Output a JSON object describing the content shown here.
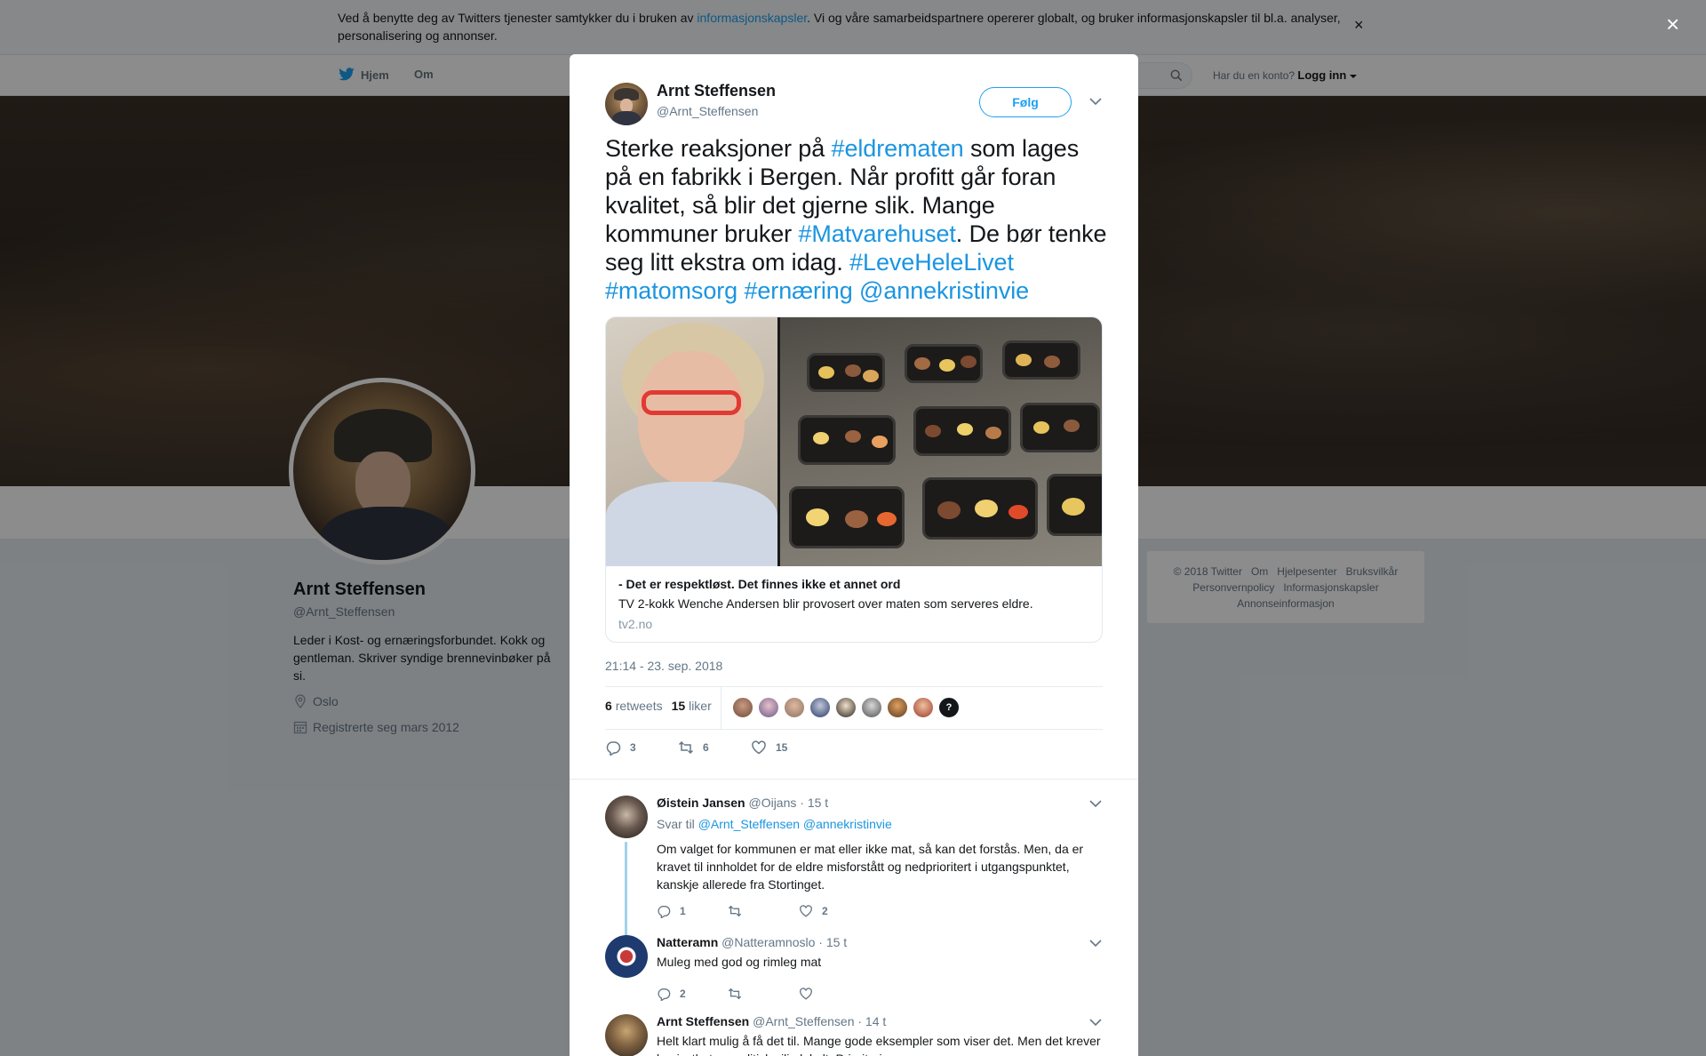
{
  "cookie": {
    "text_before": "Ved å benytte deg av Twitters tjenester samtykker du i bruken av ",
    "link": "informasjonskapsler",
    "text_after": ". Vi og våre samarbeidspartnere opererer globalt, og bruker informasjonskapsler til bl.a. analyser, personalisering og annonser.",
    "close": "×"
  },
  "nav": {
    "home": "Hjem",
    "about": "Om",
    "have_account": "Har du en konto?",
    "login": "Logg inn"
  },
  "profile": {
    "name": "Arnt Steffensen",
    "handle": "@Arnt_Steffensen",
    "bio": "Leder i Kost- og ernæringsforbundet. Kokk og gentleman. Skriver syndige brennevinbøker på si.",
    "location": "Oslo",
    "joined": "Registrerte seg mars 2012"
  },
  "footer": {
    "items": [
      "© 2018 Twitter",
      "Om",
      "Hjelpesenter",
      "Bruksvilkår",
      "Personvernpolicy",
      "Informasjonskapsler",
      "Annonseinformasjon"
    ]
  },
  "overlay": {
    "close": "×"
  },
  "tweet": {
    "author_name": "Arnt Steffensen",
    "author_handle": "@Arnt_Steffensen",
    "follow": "Følg",
    "text": [
      {
        "t": "Sterke reaksjoner på ",
        "tag": false
      },
      {
        "t": "#eldrematen",
        "tag": true
      },
      {
        "t": " som lages på en fabrikk i Bergen. Når profitt går foran kvalitet, så blir det gjerne slik. Mange kommuner bruker ",
        "tag": false
      },
      {
        "t": "#Matvarehuset",
        "tag": true
      },
      {
        "t": ". De bør tenke seg litt ekstra om idag. ",
        "tag": false
      },
      {
        "t": "#LeveHeleLivet",
        "tag": true
      },
      {
        "t": " ",
        "tag": false
      },
      {
        "t": "#matomsorg",
        "tag": true
      },
      {
        "t": " ",
        "tag": false
      },
      {
        "t": "#ernæring",
        "tag": true
      },
      {
        "t": " ",
        "tag": false
      },
      {
        "t": "@annekristinvie",
        "tag": true
      }
    ],
    "card": {
      "title": "- Det er respektløst. Det finnes ikke et annet ord",
      "description": "TV 2-kokk Wenche Andersen blir provosert over maten som serveres eldre.",
      "domain": "tv2.no"
    },
    "timestamp": "21:14 - 23. sep. 2018",
    "retweets_count": "6",
    "retweets_label": "retweets",
    "likes_count": "15",
    "likes_label": "liker",
    "likers_more": "?",
    "actions": {
      "replies": "3",
      "retweets": "6",
      "likes": "15"
    }
  },
  "replies": [
    {
      "name": "Øistein Jansen",
      "handle": "@Oijans",
      "time": "· 15 t",
      "reply_to_label": "Svar til",
      "reply_to": "@Arnt_Steffensen @annekristinvie",
      "text": "Om valget for kommunen er mat eller ikke mat, så kan det forstås. Men, da er kravet til innholdet for de eldre misforstått og nedprioritert i utgangspunktet, kanskje allerede fra Stortinget.",
      "replies": "1",
      "retweets": "",
      "likes": "2"
    },
    {
      "name": "Natteramn",
      "handle": "@Natteramnoslo",
      "time": "· 15 t",
      "text": "Muleg med god og rimleg mat",
      "replies": "2",
      "retweets": "",
      "likes": ""
    },
    {
      "name": "Arnt Steffensen",
      "handle": "@Arnt_Steffensen",
      "time": "· 14 t",
      "text": "Helt klart mulig å få det til. Mange gode eksempler som viser det. Men det krever bevissthet og politisk vilje lokalt. Prioriteringer"
    }
  ],
  "colors": {
    "accent": "#1da1f2",
    "link": "#1b95e0",
    "thread": "#9fd3e9"
  }
}
